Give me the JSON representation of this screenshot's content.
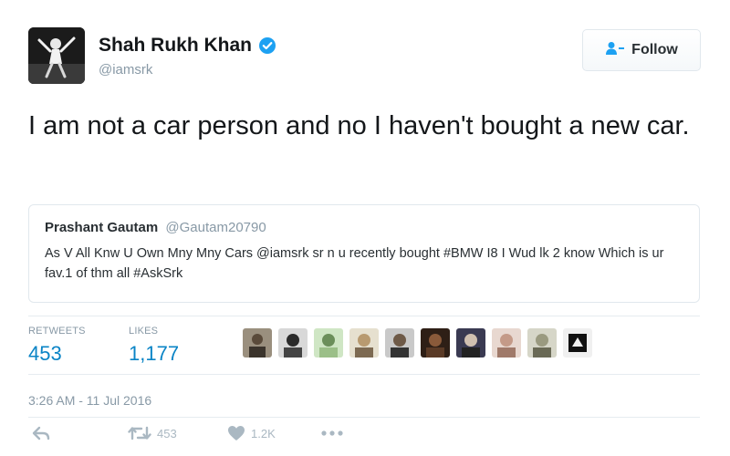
{
  "author": {
    "display_name": "Shah Rukh Khan",
    "handle": "@iamsrk",
    "verified": true
  },
  "follow_button": {
    "label": "Follow"
  },
  "tweet": {
    "text": "I am not a car person and no I haven't bought a new car."
  },
  "quoted_tweet": {
    "name": "Prashant Gautam",
    "handle": "@Gautam20790",
    "text": "As V All Knw U Own Mny Mny Cars @iamsrk sr n u recently bought #BMW I8 I Wud lk 2 know Which is ur fav.1 of thm all #AskSrk"
  },
  "stats": {
    "retweets_label": "RETWEETS",
    "retweets_count": "453",
    "likes_label": "LIKES",
    "likes_count": "1,177"
  },
  "timestamp": "3:26 AM - 11 Jul 2016",
  "actions": {
    "retweet_count": "453",
    "like_count": "1.2K"
  },
  "colors": {
    "link_blue": "#0a84c6",
    "verified_blue": "#1da1f2",
    "muted_gray": "#8899a6",
    "action_gray": "#aab8c2"
  },
  "icons": [
    "verified-icon",
    "follow-user-icon",
    "reply-icon",
    "retweet-icon",
    "heart-icon",
    "more-icon"
  ]
}
